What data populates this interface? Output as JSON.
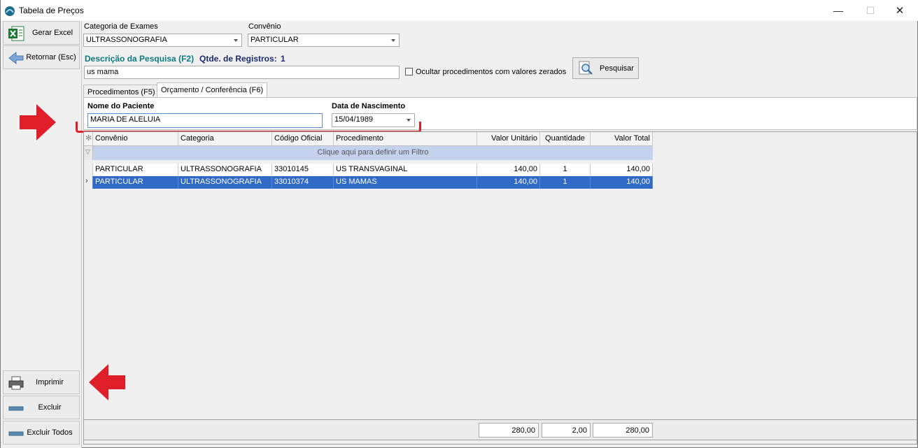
{
  "window": {
    "title": "Tabela de Preços",
    "controls": {
      "minimize": "—",
      "maximize": "☐",
      "close": "✕"
    }
  },
  "sidebar": {
    "gerar_excel": "Gerar Excel",
    "retornar": "Retornar (Esc)",
    "imprimir": "Imprimir",
    "excluir": "Excluir",
    "excluir_todos": "Excluir Todos"
  },
  "filters": {
    "categoria_label": "Categoria de Exames",
    "categoria_value": "ULTRASSONOGRAFIA",
    "convenio_label": "Convênio",
    "convenio_value": "PARTICULAR",
    "descricao_label": "Descrição da Pesquisa (F2)",
    "qtde_label": "Qtde. de Registros:",
    "qtde_value": "1",
    "search_value": "us mama",
    "ocultar_label": "Ocultar procedimentos com valores zerados",
    "pesquisar_label": "Pesquisar"
  },
  "tabs": [
    {
      "label": "Procedimentos  (F5)",
      "active": false
    },
    {
      "label": "Orçamento / Conferência  (F6)",
      "active": true
    }
  ],
  "patient": {
    "nome_label": "Nome do Paciente",
    "nome_value": "MARIA DE ALELUIA",
    "nascimento_label": "Data de Nascimento",
    "nascimento_value": "15/04/1989"
  },
  "grid": {
    "columns": [
      "Convênio",
      "Categoria",
      "Código Oficial",
      "Procedimento",
      "Valor Unitário",
      "Quantidade",
      "Valor Total"
    ],
    "filter_hint": "Clique aqui para definir um Filtro",
    "rows": [
      {
        "convenio": "PARTICULAR",
        "categoria": "ULTRASSONOGRAFIA",
        "codigo": "33010145",
        "procedimento": "US TRANSVAGINAL",
        "valor_unitario": "140,00",
        "quantidade": "1",
        "valor_total": "140,00",
        "selected": false
      },
      {
        "convenio": "PARTICULAR",
        "categoria": "ULTRASSONOGRAFIA",
        "codigo": "33010374",
        "procedimento": "US MAMAS",
        "valor_unitario": "140,00",
        "quantidade": "1",
        "valor_total": "140,00",
        "selected": true
      }
    ]
  },
  "totals": {
    "valor_unitario": "280,00",
    "quantidade": "2,00",
    "valor_total": "280,00"
  },
  "colors": {
    "selection": "#3169c6",
    "filter_row": "#c5d2ee",
    "annotation_red": "#e01e2a",
    "label_teal": "#0b7a83",
    "label_navy": "#1a2a6c"
  }
}
